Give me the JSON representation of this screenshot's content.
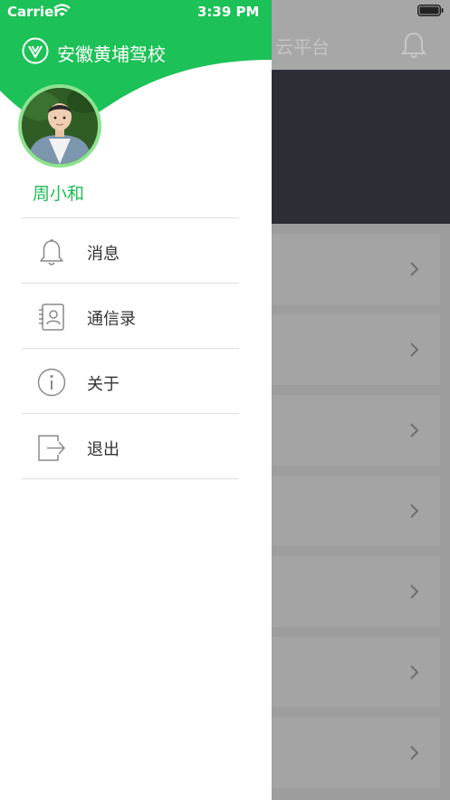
{
  "status_bar": {
    "carrier": "Carrier",
    "time": "3:39 PM"
  },
  "background": {
    "title": "云平台"
  },
  "drawer": {
    "school_name": "安徽黄埔驾校",
    "user_name": "周小和",
    "menu": [
      {
        "id": "messages",
        "label": "消息",
        "icon": "bell-icon"
      },
      {
        "id": "contacts",
        "label": "通信录",
        "icon": "contacts-icon"
      },
      {
        "id": "about",
        "label": "关于",
        "icon": "info-icon"
      },
      {
        "id": "logout",
        "label": "退出",
        "icon": "logout-icon"
      }
    ]
  },
  "colors": {
    "brand_green": "#1cc157",
    "avatar_ring": "#8de28f",
    "banner_dark": "#2b2e35"
  }
}
